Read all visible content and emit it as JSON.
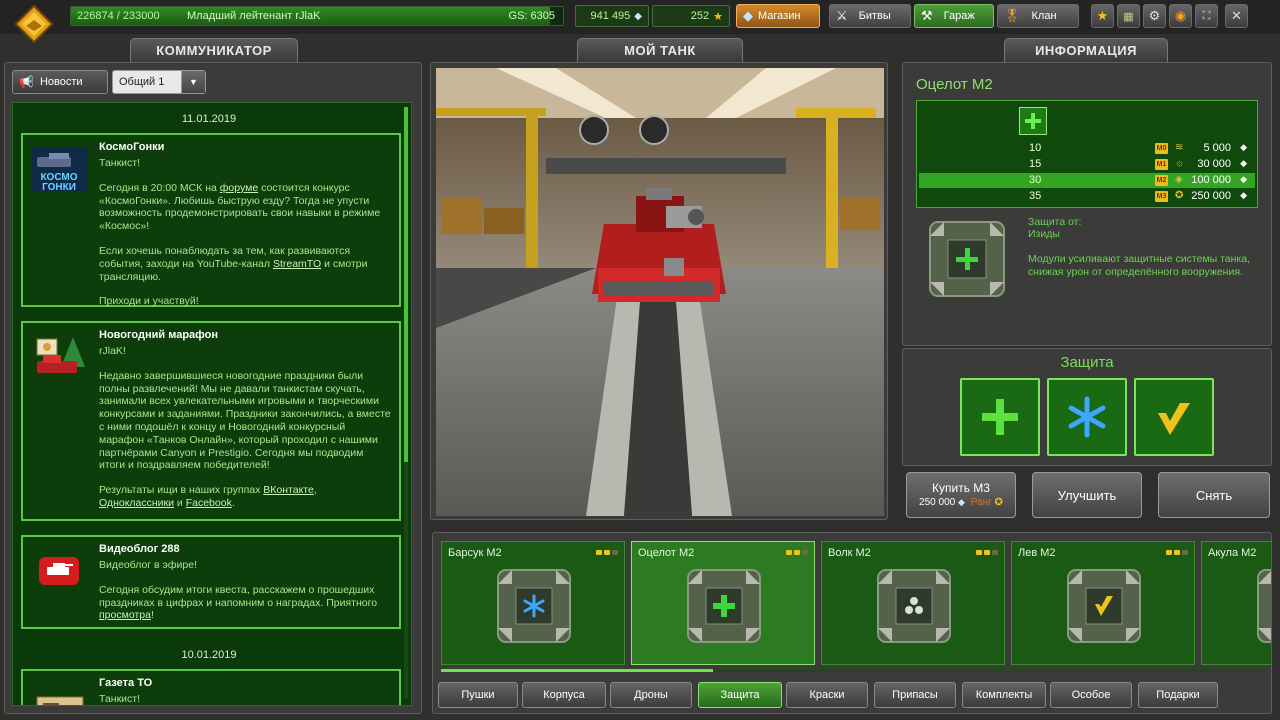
{
  "topbar": {
    "xp_text": "226874 / 233000",
    "rank_name": "Младший лейтенант rJlaK",
    "gs": "GS: 6305",
    "xp_fraction": 0.974,
    "crystals": "941 495",
    "stars": "252",
    "shop_label": "Магазин",
    "battles_label": "Битвы",
    "garage_label": "Гараж",
    "clan_label": "Клан",
    "icon_buttons": [
      "star-icon",
      "missions-icon",
      "settings-icon",
      "sound-icon",
      "fullscreen-icon",
      "close-icon"
    ]
  },
  "communicator": {
    "title": "КОММУНИКАТОР",
    "news_button": "Новости",
    "channel_select": "Общий 1",
    "scroll_fraction": 0.6,
    "date1": "11.01.2019",
    "date2": "10.01.2019",
    "cards": [
      {
        "title": "КосмоГонки",
        "greeting": "Танкист!",
        "p1_a": "Сегодня в 20:00 МСК на ",
        "p1_link": "форуме",
        "p1_b": " состоится конкурс «КосмоГонки». Любишь быструю езду? Тогда не упусти возможность продемонстрировать свои навыки в режиме «Космос»!",
        "p2_a": "Если хочешь понаблюдать за тем, как развиваются события, заходи на YouTube-канал ",
        "p2_link": "StreamTO",
        "p2_b": " и смотри трансляцию.",
        "p3": "Приходи и участвуй!"
      },
      {
        "title": "Новогодний марафон",
        "greeting": "rJlaK!",
        "p1": "Недавно завершившиеся новогодние праздники были полны развлечений! Мы не давали танкистам скучать, занимали всех увлекательными игровыми и творческими конкурсами и заданиями. Праздники закончились, а вместе с ними подошёл к концу и Новогодний конкурсный марафон «Танков Онлайн», который проходил с нашими партнёрами Canyon и Prestigio. Сегодня мы подводим итоги и поздравляем победителей!",
        "p2_a": "Результаты ищи в наших группах ",
        "p2_link1": "ВКонтакте",
        "p2_sep": ", ",
        "p2_link2": "Одноклассники",
        "p2_and": " и ",
        "p2_link3": "Facebook",
        "p2_end": "."
      },
      {
        "title": "Видеоблог 288",
        "greeting": "Видеоблог в эфире!",
        "p1_a": "Сегодня обсудим итоги квеста, расскажем о прошедших праздниках в цифрах и напомним о наградах. Приятного ",
        "p1_link": "просмотра",
        "p1_b": "!"
      },
      {
        "title": "Газета ТО",
        "greeting": "Танкист!"
      }
    ]
  },
  "mytank": {
    "title": "МОЙ ТАНК"
  },
  "info": {
    "title": "ИНФОРМАЦИЯ",
    "item_name": "Оцелот М2",
    "upgrades": [
      {
        "level": "10",
        "mark": "M0",
        "price": "5 000"
      },
      {
        "level": "15",
        "mark": "M1",
        "price": "30 000"
      },
      {
        "level": "30",
        "mark": "M2",
        "price": "100 000"
      },
      {
        "level": "35",
        "mark": "M3",
        "price": "250 000"
      }
    ],
    "protection_from": "Защита от:",
    "protection_target": "Изиды",
    "description": "Модули усиливают защитные системы танка, снижая урон от определённого вооружения.",
    "protection_title": "Защита",
    "buy_label": "Купить М3",
    "buy_price": "250 000",
    "rank_label": "Ранг",
    "upgrade_label": "Улучшить",
    "remove_label": "Снять"
  },
  "garage_items": [
    {
      "name": "Барсук М2",
      "icon": "freeze-icon",
      "selected": false
    },
    {
      "name": "Оцелот М2",
      "icon": "isida-icon",
      "selected": true
    },
    {
      "name": "Волк М2",
      "icon": "smoky-icon",
      "selected": false
    },
    {
      "name": "Лев М2",
      "icon": "firebird-icon",
      "selected": false
    },
    {
      "name": "Акула М2",
      "icon": "thunder-icon",
      "selected": false
    }
  ],
  "strip_progress": 0.33,
  "categories": [
    "Пушки",
    "Корпуса",
    "Дроны",
    "Защита",
    "Краски",
    "Припасы",
    "Комплекты",
    "Особое",
    "Подарки"
  ],
  "active_category": "Защита",
  "colors": {
    "accent_green": "#5ec84a",
    "panel": "#3b3b3a",
    "feed_bg": "#0a3a0a"
  }
}
